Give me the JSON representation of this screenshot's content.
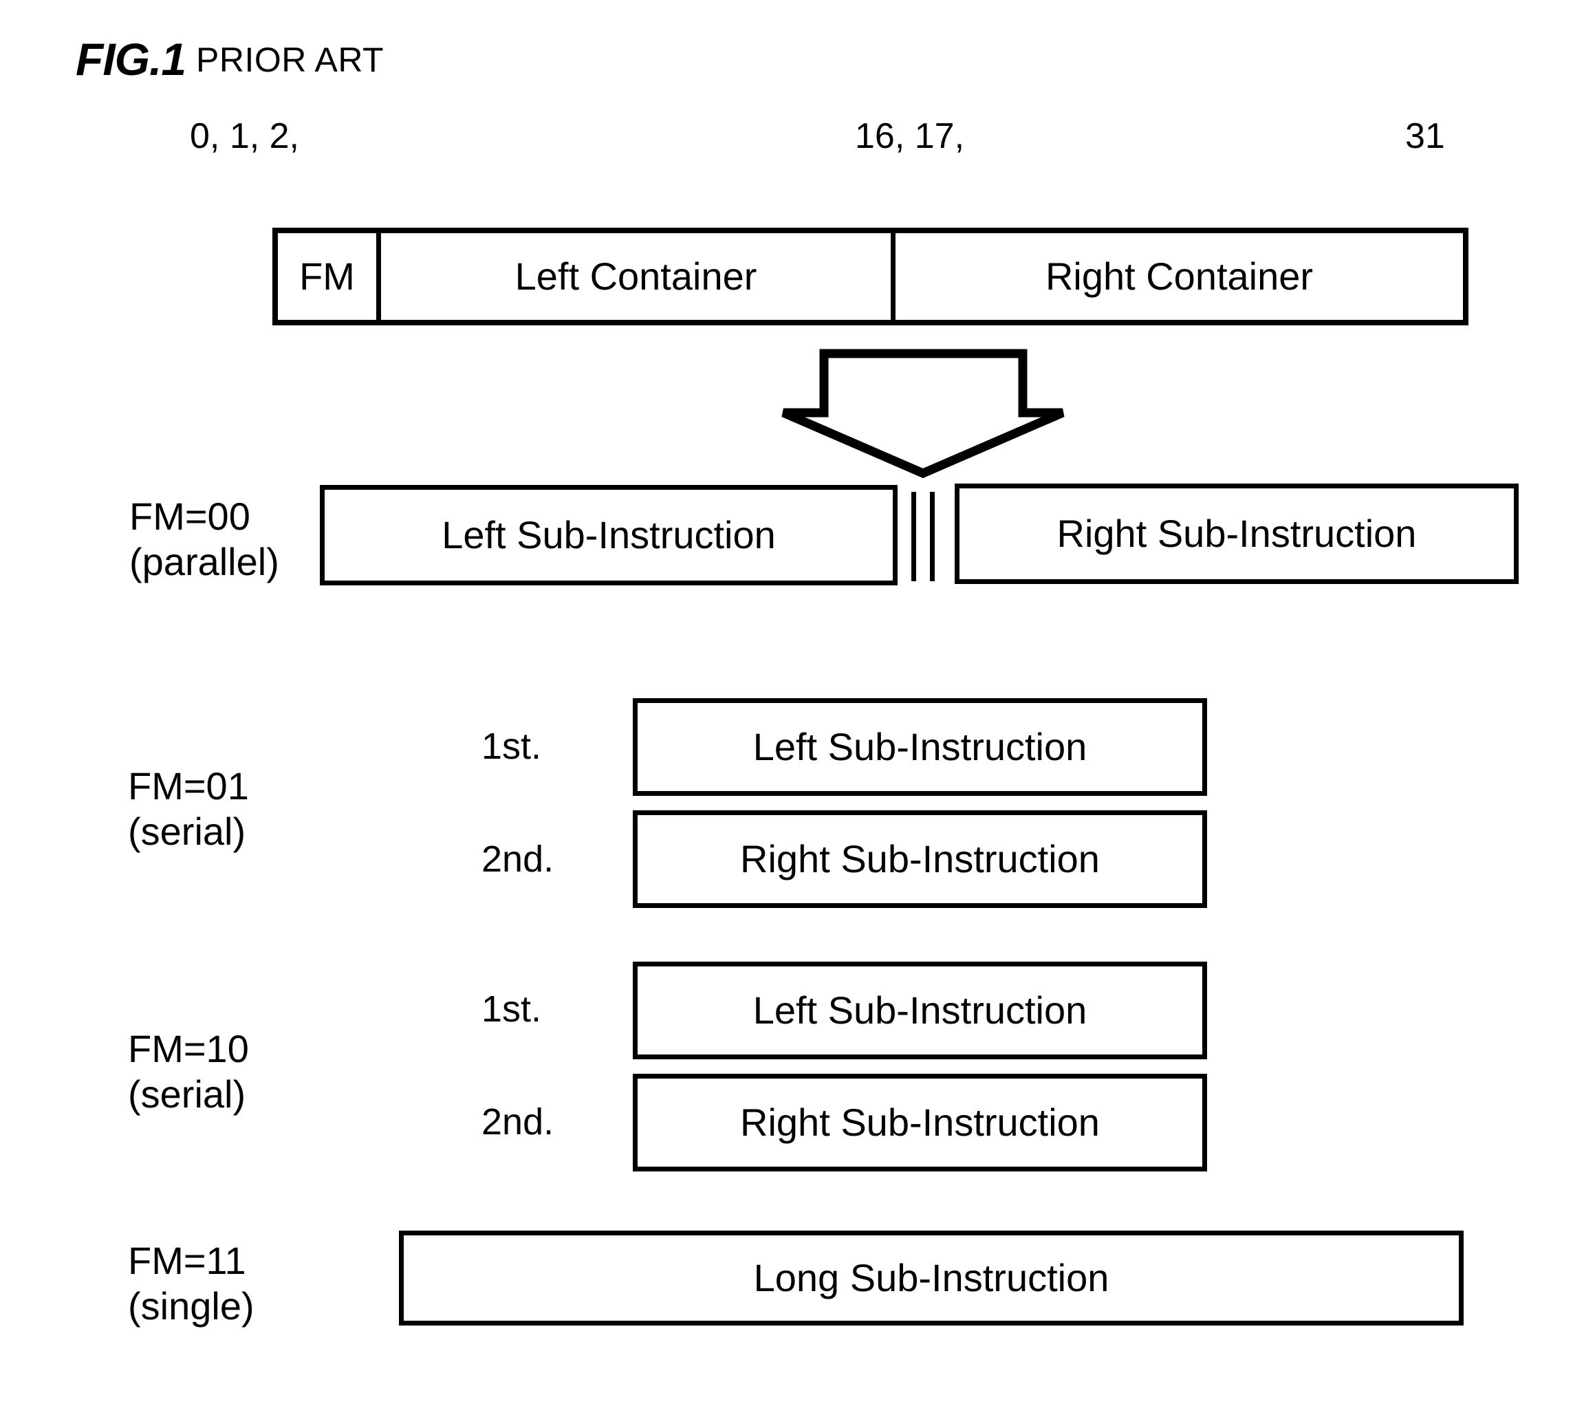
{
  "figure": {
    "title": "FIG.1",
    "subtitle": "PRIOR ART"
  },
  "bit_ruler": {
    "left_bits": "0, 1, 2,",
    "mid_bits": "16, 17,",
    "right_bit": "31"
  },
  "instruction_word": {
    "fm_field": "FM",
    "left_container": "Left Container",
    "right_container": "Right Container"
  },
  "arrow": {
    "icon": "down-block-arrow-icon"
  },
  "formats": [
    {
      "code": "FM=00",
      "mode": "(parallel)",
      "left_sub": "Left Sub-Instruction",
      "right_sub": "Right Sub-Instruction",
      "separator": "||"
    },
    {
      "code": "FM=01",
      "mode": "(serial)",
      "first_label": "1st.",
      "second_label": "2nd.",
      "first_sub": "Left Sub-Instruction",
      "second_sub": "Right Sub-Instruction"
    },
    {
      "code": "FM=10",
      "mode": "(serial)",
      "first_label": "1st.",
      "second_label": "2nd.",
      "first_sub": "Left Sub-Instruction",
      "second_sub": "Right Sub-Instruction"
    },
    {
      "code": "FM=11",
      "mode": "(single)",
      "long_sub": "Long Sub-Instruction"
    }
  ],
  "colors": {
    "ink": "#000000",
    "paper": "#ffffff"
  }
}
